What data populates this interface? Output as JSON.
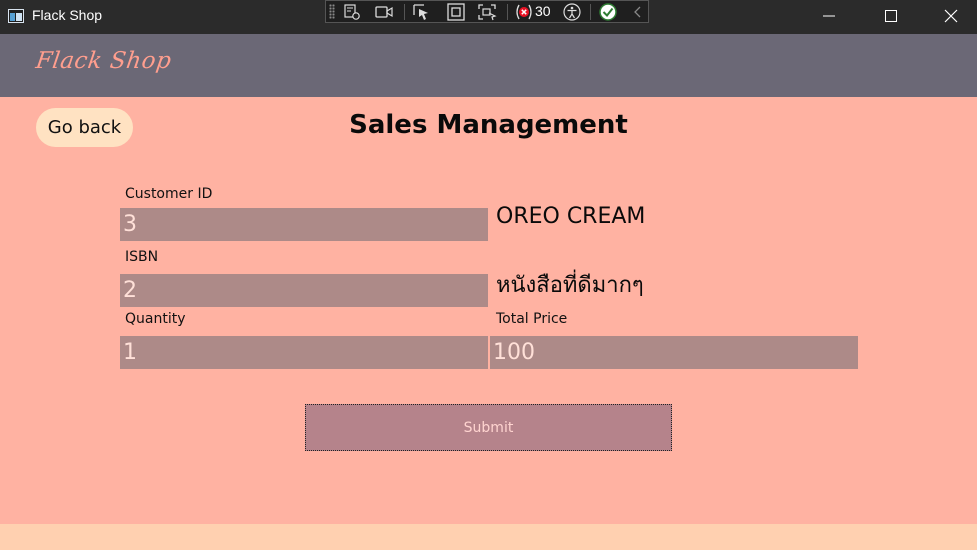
{
  "window": {
    "title": "Flack Shop",
    "controls": [
      "minimize-icon",
      "maximize-icon",
      "close-icon"
    ]
  },
  "debug_toolbar": {
    "icons": [
      "live-visual-tree-icon",
      "record-icon",
      "select-element-icon",
      "display-layout-adorners-icon",
      "track-focus-icon",
      "binding-failures-icon",
      "accessibility-icon",
      "hot-reload-ok-icon",
      "collapse-icon"
    ],
    "binding_failures_count": "30"
  },
  "header": {
    "logo": "Flack Shop"
  },
  "page": {
    "go_back_label": "Go back",
    "title": "Sales Management"
  },
  "form": {
    "customer_id": {
      "label": "Customer ID",
      "value": "3",
      "resolved": "OREO CREAM"
    },
    "isbn": {
      "label": "ISBN",
      "value": "2",
      "resolved": "หนังสือที่ดีมากๆ"
    },
    "quantity": {
      "label": "Quantity",
      "value": "1"
    },
    "total_price": {
      "label": "Total Price",
      "value": "100"
    },
    "submit_label": "Submit"
  },
  "colors": {
    "titlebar": "#2b2b2b",
    "header": "#6b6876",
    "logo": "#ff9e8e",
    "content_bg": "#ffb2a2",
    "go_back_bg": "#ffe2c2",
    "field_bg": "#ad8a88",
    "submit_bg": "#b5838b",
    "footer": "#ffd0b0"
  }
}
